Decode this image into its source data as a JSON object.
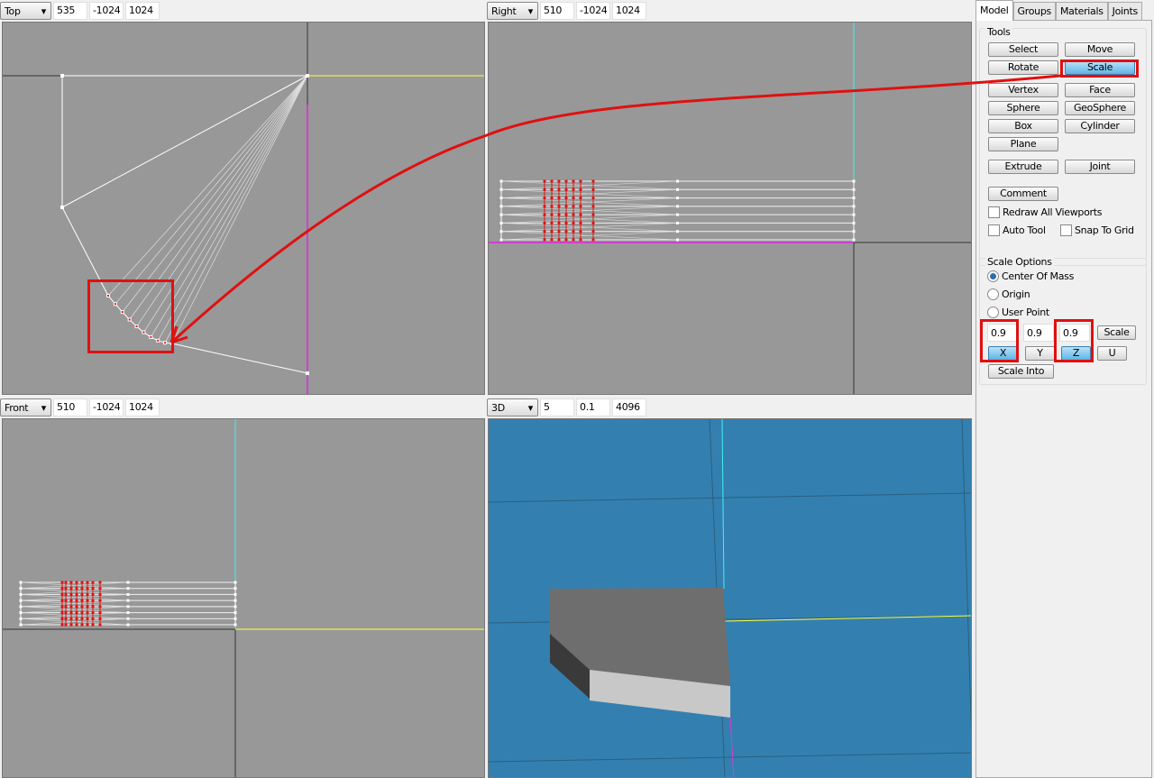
{
  "viewports": [
    {
      "view": "Top",
      "values": [
        "535",
        "-1024",
        "1024"
      ]
    },
    {
      "view": "Right",
      "values": [
        "510",
        "-1024",
        "1024"
      ]
    },
    {
      "view": "Front",
      "values": [
        "510",
        "-1024",
        "1024"
      ]
    },
    {
      "view": "3D",
      "values": [
        "5",
        "0.1",
        "4096"
      ]
    }
  ],
  "tabs": [
    "Model",
    "Groups",
    "Materials",
    "Joints"
  ],
  "tools": {
    "title": "Tools",
    "select": "Select",
    "move": "Move",
    "rotate": "Rotate",
    "scale": "Scale",
    "vertex": "Vertex",
    "face": "Face",
    "sphere": "Sphere",
    "geosphere": "GeoSphere",
    "box": "Box",
    "cylinder": "Cylinder",
    "plane": "Plane",
    "extrude": "Extrude",
    "joint": "Joint",
    "comment": "Comment",
    "redraw": "Redraw All Viewports",
    "autotool": "Auto Tool",
    "snap": "Snap To Grid"
  },
  "scale_options": {
    "title": "Scale Options",
    "center": "Center Of Mass",
    "origin": "Origin",
    "user": "User Point",
    "x_value": "0.9",
    "y_value": "0.9",
    "z_value": "0.9",
    "scale_btn": "Scale",
    "x": "X",
    "y": "Y",
    "z": "Z",
    "u": "U",
    "scale_into": "Scale Into",
    "selected_origin": "Center Of Mass",
    "active_axes": [
      "X",
      "Z"
    ]
  },
  "colors": {
    "viewport_bg": "#989898",
    "view3d_bg": "#3380b0",
    "annotation": "#e01010",
    "selected_button": "#5fb3e6"
  }
}
